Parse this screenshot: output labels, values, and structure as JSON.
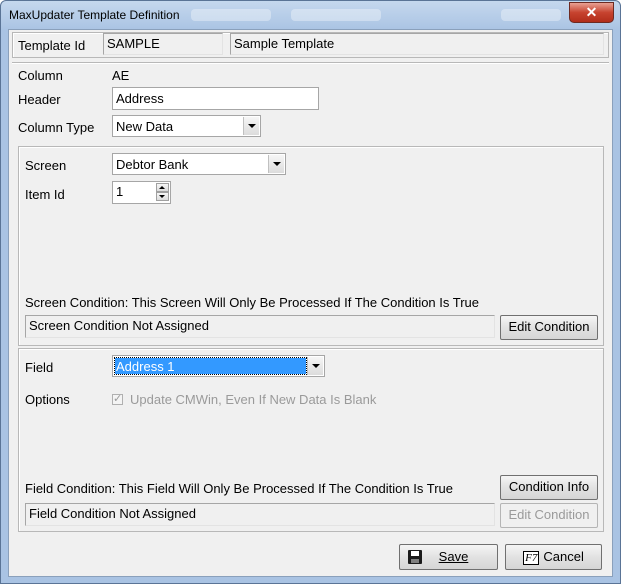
{
  "window": {
    "title": "MaxUpdater Template Definition",
    "close_glyph": "✕"
  },
  "template": {
    "id_label": "Template  Id",
    "id_value": "SAMPLE",
    "name_value": "Sample Template"
  },
  "column": {
    "column_label": "Column",
    "column_value": "AE",
    "header_label": "Header",
    "header_value": "Address",
    "type_label": "Column Type",
    "type_value": "New Data"
  },
  "screen_group": {
    "screen_label": "Screen",
    "screen_value": "Debtor Bank",
    "item_id_label": "Item Id",
    "item_id_value": "1",
    "condition_caption": "Screen Condition: This Screen Will Only Be Processed If The Condition Is True",
    "condition_value": "Screen Condition Not Assigned",
    "edit_condition_label": "Edit Condition"
  },
  "field_group": {
    "field_label": "Field",
    "field_value": "Address 1",
    "options_label": "Options",
    "option_update_label": "Update CMWin, Even If New Data Is Blank",
    "option_update_checked": true,
    "condition_caption": "Field Condition: This Field Will Only Be Processed If The Condition Is True",
    "condition_info_label": "Condition Info",
    "condition_value": "Field Condition Not Assigned",
    "edit_condition_label": "Edit Condition"
  },
  "footer": {
    "save_label": "Save",
    "cancel_key": "F7",
    "cancel_label": "Cancel"
  },
  "colors": {
    "selection": "#3399ff",
    "titlebar": "#b6cde9",
    "close_button": "#c7432f"
  }
}
